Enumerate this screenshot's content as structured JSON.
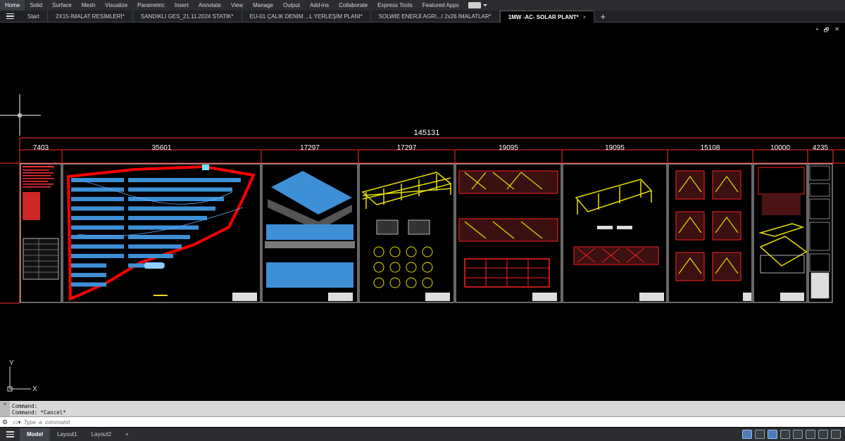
{
  "ribbon": {
    "tabs": [
      "Home",
      "Solid",
      "Surface",
      "Mesh",
      "Visualize",
      "Parametric",
      "Insert",
      "Annotate",
      "View",
      "Manage",
      "Output",
      "Add-ins",
      "Collaborate",
      "Express Tools",
      "Featured Apps"
    ],
    "active_index": 0
  },
  "file_tabs": {
    "start": "Start",
    "tabs": [
      "2X15-İMALAT RESİMLERİ*",
      "SANDIKLI GES_21.11.2024 STATİK*",
      "EU-01 ÇALIK DENİM ...L YERLEŞİM PLANI*",
      "SOLWIE ENERJİ AGRI...I 2x26 İMALATLAR*",
      "1MW -AC- SOLAR PLANT*"
    ],
    "active_index": 4,
    "close": "×",
    "add": "+"
  },
  "viewport_controls": [
    "▪",
    "🗗",
    "✕"
  ],
  "drawing": {
    "total_dimension": "145131",
    "dimensions": [
      "7403",
      "35601",
      "17297",
      "17297",
      "19095",
      "19095",
      "15108",
      "10000",
      "4235"
    ],
    "ucs_x": "X",
    "ucs_y": "Y"
  },
  "command": {
    "history": [
      "Command:",
      "Command: *Cancel*"
    ],
    "placeholder": "Type  a  command",
    "side_close": "×",
    "side_gear": "⚙"
  },
  "status": {
    "tabs": [
      "Model",
      "Layout1",
      "Layout2"
    ],
    "active_index": 0,
    "add": "+"
  },
  "colors": {
    "boundary": "#ff0000",
    "panel": "#3d8fd6",
    "structure": "#e6e000",
    "frame": "#ffffff"
  }
}
